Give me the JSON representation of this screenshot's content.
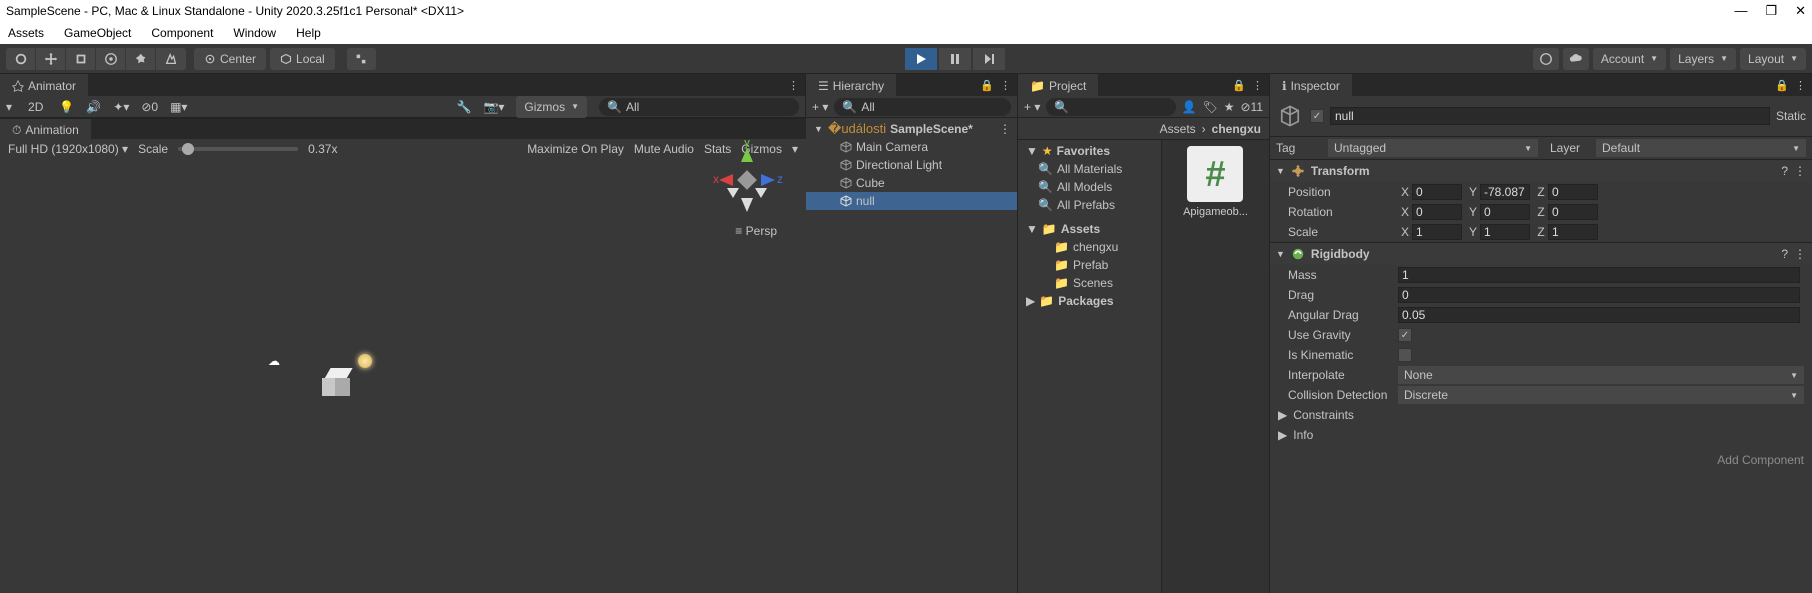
{
  "title": "SampleScene - PC, Mac & Linux Standalone - Unity 2020.3.25f1c1 Personal* <DX11>",
  "menu": {
    "assets": "Assets",
    "go": "GameObject",
    "comp": "Component",
    "win": "Window",
    "help": "Help"
  },
  "toolbar": {
    "center": "Center",
    "local": "Local",
    "account": "Account",
    "layers": "Layers",
    "layout": "Layout"
  },
  "animator": {
    "title": "Animator"
  },
  "scene": {
    "twod": "2D",
    "gizmos": "Gizmos",
    "search": "All",
    "persp": "Persp",
    "axes": {
      "x": "x",
      "y": "y",
      "z": "z"
    }
  },
  "hierarchy": {
    "title": "Hierarchy",
    "search": "All",
    "scene": "SampleScene*",
    "items": [
      "Main Camera",
      "Directional Light",
      "Cube",
      "null"
    ]
  },
  "project": {
    "title": "Project",
    "search": "",
    "crumb1": "Assets",
    "crumb2": "chengxu",
    "favorites": "Favorites",
    "fav": [
      "All Materials",
      "All Models",
      "All Prefabs"
    ],
    "assets": "Assets",
    "folders": [
      "chengxu",
      "Prefab",
      "Scenes"
    ],
    "packages": "Packages",
    "thumb": "Apigameob...",
    "hidden": "11"
  },
  "inspector": {
    "title": "Inspector",
    "name": "null",
    "static": "Static",
    "tag": "Tag",
    "tagval": "Untagged",
    "layer": "Layer",
    "layerval": "Default",
    "transform": {
      "title": "Transform",
      "pos": "Position",
      "rot": "Rotation",
      "scale": "Scale",
      "px": "0",
      "py": "-78.087",
      "pz": "0",
      "rx": "0",
      "ry": "0",
      "rz": "0",
      "sx": "1",
      "sy": "1",
      "sz": "1",
      "x": "X",
      "y": "Y",
      "z": "Z"
    },
    "rigidbody": {
      "title": "Rigidbody",
      "mass": "Mass",
      "massv": "1",
      "drag": "Drag",
      "dragv": "0",
      "adrag": "Angular Drag",
      "adragv": "0.05",
      "grav": "Use Gravity",
      "kin": "Is Kinematic",
      "interp": "Interpolate",
      "interpv": "None",
      "coll": "Collision Detection",
      "collv": "Discrete",
      "constraints": "Constraints",
      "info": "Info"
    },
    "addcomp": "Add Component"
  },
  "animation": {
    "title": "Animation",
    "res": "Full HD (1920x1080)",
    "scale": "Scale",
    "scalev": "0.37x",
    "max": "Maximize On Play",
    "mute": "Mute Audio",
    "stats": "Stats",
    "gizmos": "Gizmos"
  }
}
